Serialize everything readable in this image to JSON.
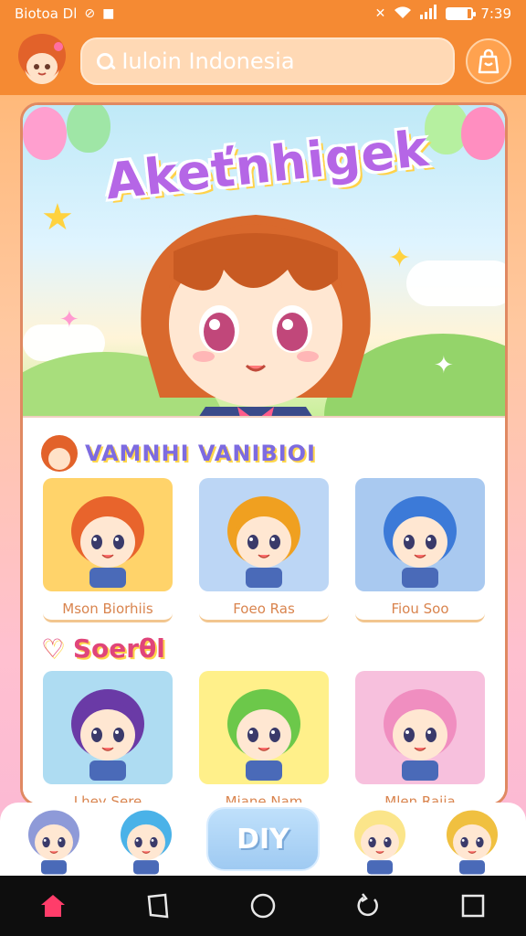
{
  "status_bar": {
    "left_text": "Biotoa Dl",
    "time": "7:39",
    "battery_level": 0.85
  },
  "app_bar": {
    "search_value": "Iuloin Indonesia",
    "search_icon": "search-icon",
    "profile_icon": "bag-icon",
    "brand_color": "#f58a33"
  },
  "hero": {
    "title": "Akeťnhigek"
  },
  "section1": {
    "title": "VAMNHI VANIBIOI",
    "items": [
      {
        "label": "Mson Biorhiis",
        "bg": "#ffd36a",
        "hair": "#e8642c"
      },
      {
        "label": "Foeo Ras",
        "bg": "#bcd6f5",
        "hair": "#f0a020"
      },
      {
        "label": "Fiou Soo",
        "bg": "#a9c9f0",
        "hair": "#3c7ad8"
      }
    ]
  },
  "section2": {
    "title": "Soerθl",
    "items": [
      {
        "label": "Lhey Sere",
        "bg": "#aedcf2",
        "hair": "#6a3aa6"
      },
      {
        "label": "Miane Nam",
        "bg": "#fff08a",
        "hair": "#6cc84a"
      },
      {
        "label": "Mlen Raiia",
        "bg": "#f7c0dd",
        "hair": "#f08ec0"
      }
    ]
  },
  "bottom_bar": {
    "diy_label": "DIY",
    "characters": [
      "#8e9ad8",
      "#4ab2e8",
      "#fbe58a",
      "#f0c040"
    ]
  },
  "nav": {
    "home_color": "#ff3d6a",
    "icons": [
      "home-icon",
      "back-icon",
      "circle-home-icon",
      "recents-icon",
      "square-icon"
    ]
  }
}
